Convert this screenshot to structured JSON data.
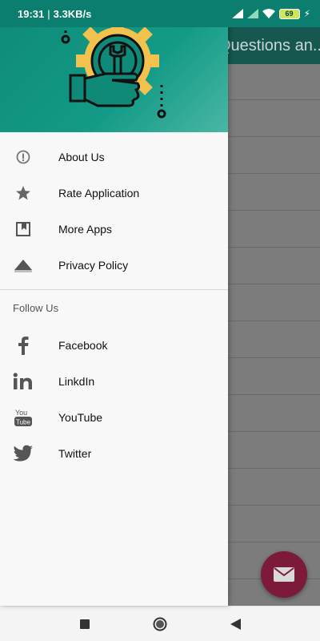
{
  "status_bar": {
    "time": "19:31",
    "speed": "3.3KB/s",
    "battery": "69"
  },
  "app": {
    "toolbar_title": "Questions an..."
  },
  "drawer": {
    "items": [
      {
        "label": "About Us",
        "icon": "info-icon"
      },
      {
        "label": "Rate Application",
        "icon": "star-icon"
      },
      {
        "label": "More Apps",
        "icon": "bookmark-icon"
      },
      {
        "label": "Privacy Policy",
        "icon": "triangle-icon"
      }
    ],
    "section_title": "Follow Us",
    "social": [
      {
        "label": "Facebook",
        "icon": "facebook-icon"
      },
      {
        "label": "LinkdIn",
        "icon": "linkedin-icon"
      },
      {
        "label": "YouTube",
        "icon": "youtube-icon"
      },
      {
        "label": "Twitter",
        "icon": "twitter-icon"
      }
    ]
  },
  "colors": {
    "primary": "#0f8a78",
    "accent": "#7c1a3a",
    "logo_gear": "#f2c14e"
  }
}
